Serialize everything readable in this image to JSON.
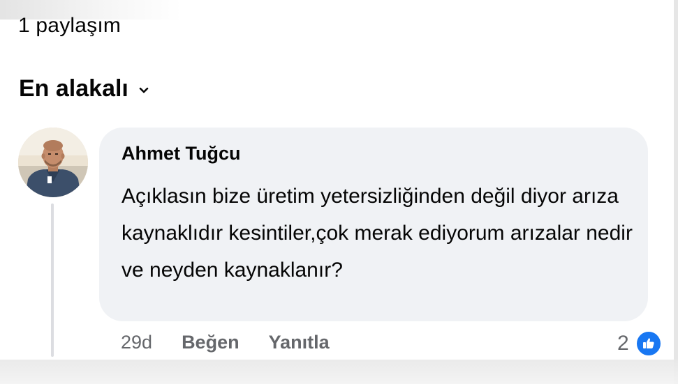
{
  "post": {
    "share_count_text": "1 paylaşım"
  },
  "sort": {
    "label": "En alakalı"
  },
  "comment": {
    "author": "Ahmet Tuğcu",
    "text": "Açıklasın bize üretim yetersizliğinden değil diyor arıza kaynaklıdır kesintiler,çok merak ediyorum arızalar nedir ve neyden kaynaklanır?",
    "time": "29d",
    "like_label": "Beğen",
    "reply_label": "Yanıtla",
    "reaction_count": "2",
    "reaction_icon": "like-icon"
  },
  "colors": {
    "bubble": "#f0f2f5",
    "meta_text": "#65676b",
    "like_blue": "#1877f2"
  }
}
